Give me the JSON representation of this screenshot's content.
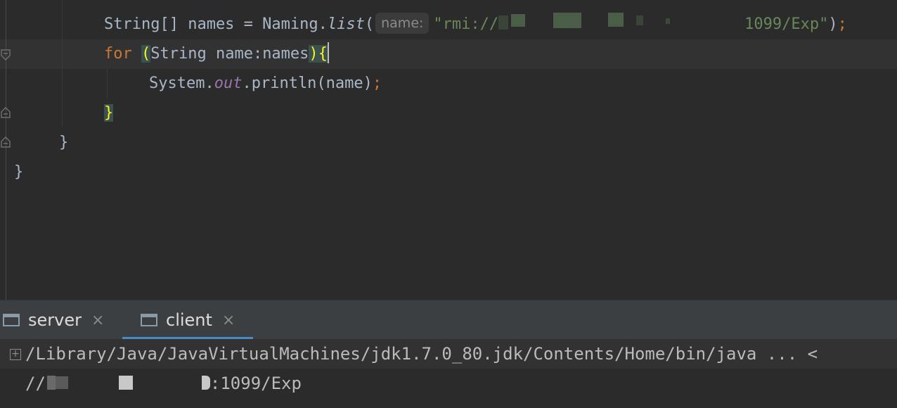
{
  "editor": {
    "line1": {
      "indent": "        ",
      "part1": "String[] names = Naming.",
      "method": "list",
      "paren_open": "(",
      "hint": "name:",
      "str_start": "\"rmi://",
      "str_end": "1099/Exp\"",
      "paren_close": ")",
      "semi": ";"
    },
    "line2": {
      "kw": "for",
      "paren_open": "(",
      "middle": "String name:names",
      "paren_close": ")",
      "brace": "{"
    },
    "line3": {
      "part1": "System.",
      "field": "out",
      "part2": ".println(name)",
      "semi": ";"
    },
    "line4": {
      "brace": "}"
    },
    "line5": {
      "brace": "}"
    },
    "line6": {
      "brace": "}"
    }
  },
  "tool_window": {
    "tabs": [
      {
        "label": "server",
        "close": "×"
      },
      {
        "label": "client",
        "close": "×"
      }
    ]
  },
  "console": {
    "expand": "+",
    "command": "/Library/Java/JavaVirtualMachines/jdk1.7.0_80.jdk/Contents/Home/bin/java ... <",
    "output_prefix": "//",
    "output_suffix": ":1099/Exp"
  }
}
